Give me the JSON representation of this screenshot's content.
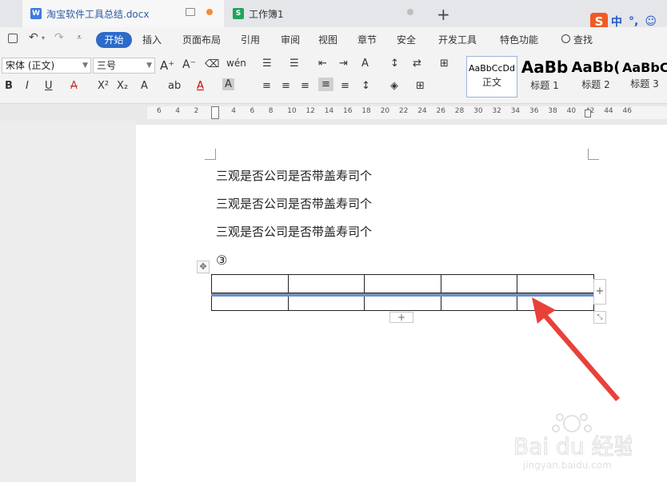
{
  "tabs": [
    {
      "label": "淘宝软件工具总结.docx",
      "icon": "W",
      "icon_color": "#3f7ae0",
      "dot_color": "#f08c3c"
    },
    {
      "label": "工作簿1",
      "icon": "S",
      "icon_color": "#22a35a",
      "dot_color": "#bdbdbd"
    }
  ],
  "new_tab": "+",
  "ime": {
    "logo": "S",
    "items": [
      "中",
      "°,",
      "☺"
    ]
  },
  "menu": {
    "active": "开始",
    "items": [
      "插入",
      "页面布局",
      "引用",
      "审阅",
      "视图",
      "章节",
      "安全",
      "开发工具",
      "特色功能",
      "查找"
    ]
  },
  "ribbon": {
    "font_name": "宋体 (正文)",
    "font_size": "三号",
    "styles": [
      {
        "sample": "AaBbCcDd",
        "name": "正文"
      },
      {
        "sample": "AaBb",
        "name": "标题 1"
      },
      {
        "sample": "AaBb(",
        "name": "标题 2"
      },
      {
        "sample": "AaBbC",
        "name": "标题 3"
      }
    ]
  },
  "ruler": {
    "numbers": [
      "6",
      "4",
      "2",
      "2",
      "4",
      "6",
      "8",
      "10",
      "12",
      "14",
      "16",
      "18",
      "20",
      "22",
      "24",
      "26",
      "28",
      "30",
      "32",
      "34",
      "36",
      "38",
      "40",
      "42",
      "44",
      "46"
    ]
  },
  "document": {
    "lines": [
      "三观是否公司是否带盖寿司个",
      "三观是否公司是否带盖寿司个",
      "三观是否公司是否带盖寿司个"
    ],
    "circled": "③",
    "table": {
      "rows": 2,
      "cols": 5
    }
  },
  "accent_color": "#2d6ac9",
  "arrow_color": "#e8413a"
}
